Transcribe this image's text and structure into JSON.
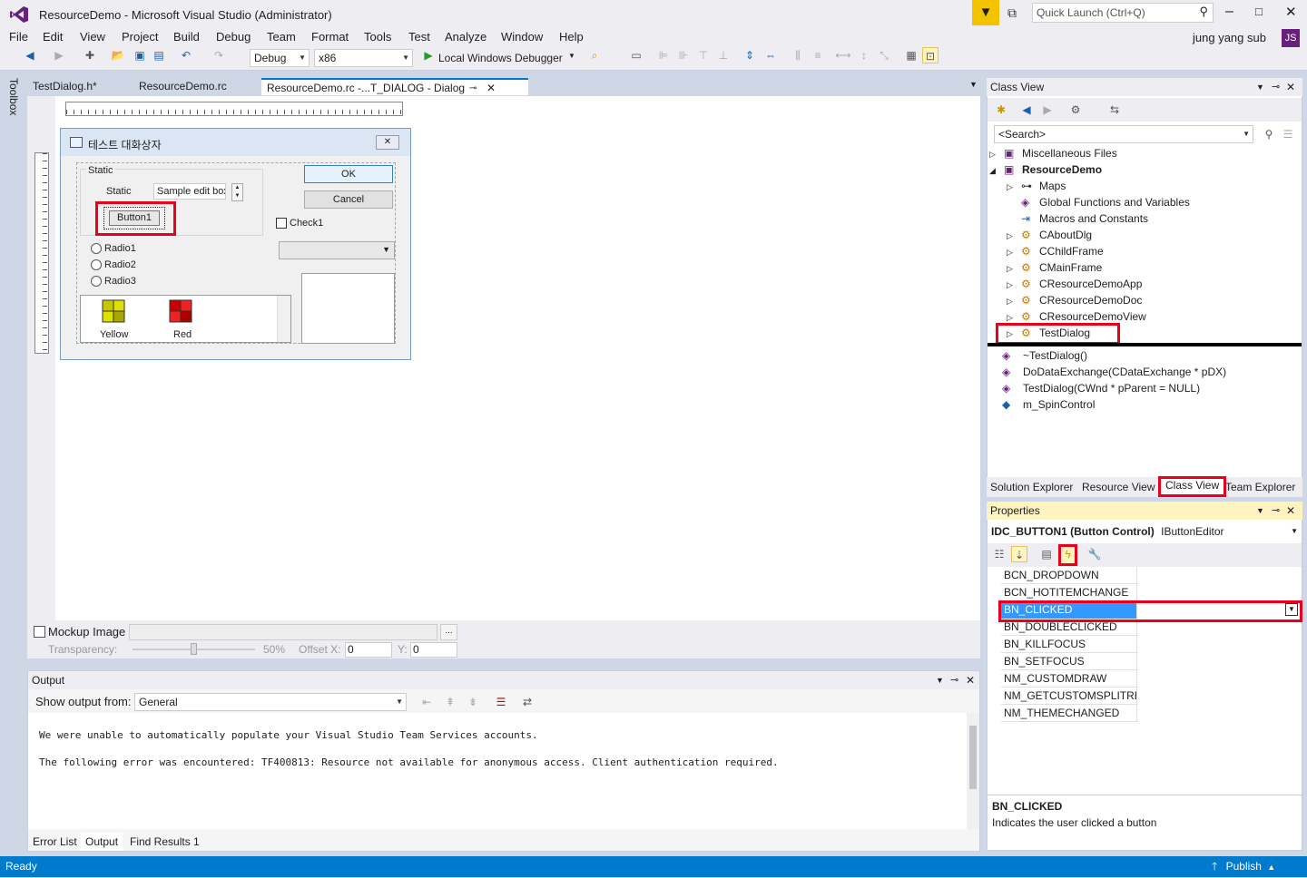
{
  "window": {
    "title": "ResourceDemo - Microsoft Visual Studio (Administrator)",
    "quick_launch_placeholder": "Quick Launch (Ctrl+Q)",
    "user": "jung yang sub",
    "user_initials": "JS"
  },
  "menu": [
    "File",
    "Edit",
    "View",
    "Project",
    "Build",
    "Debug",
    "Team",
    "Format",
    "Tools",
    "Test",
    "Analyze",
    "Window",
    "Help"
  ],
  "toolbar": {
    "config": "Debug",
    "platform": "x86",
    "debugger": "Local Windows Debugger"
  },
  "toolbox_label": "Toolbox",
  "doc_tabs": [
    "TestDialog.h*",
    "ResourceDemo.rc",
    "ResourceDemo.rc -...T_DIALOG - Dialog"
  ],
  "dialog": {
    "title": "테스트 대화상자",
    "group_label": "Static",
    "static_label": "Static",
    "edit_value": "Sample edit box",
    "button1": "Button1",
    "ok": "OK",
    "cancel": "Cancel",
    "check1": "Check1",
    "radios": [
      "Radio1",
      "Radio2",
      "Radio3"
    ],
    "list_items": [
      "Yellow",
      "Red"
    ]
  },
  "mockup": {
    "label": "Mockup Image",
    "transparency_label": "Transparency:",
    "transparency_value": "50%",
    "offset_x_label": "Offset X:",
    "offset_x": "0",
    "y_label": "Y:",
    "y": "0"
  },
  "output": {
    "title": "Output",
    "show_from_label": "Show output from:",
    "source": "General",
    "lines": [
      "We were unable to automatically populate your Visual Studio Team Services accounts.",
      "",
      "The following error was encountered: TF400813: Resource not available for anonymous access. Client authentication required."
    ]
  },
  "bottom_tabs": [
    "Error List",
    "Output",
    "Find Results 1"
  ],
  "class_view": {
    "title": "Class View",
    "search_placeholder": "<Search>",
    "tree": [
      {
        "label": "Miscellaneous Files",
        "level": 0,
        "expander": "▷"
      },
      {
        "label": "ResourceDemo",
        "level": 0,
        "expander": "◢",
        "bold": true
      },
      {
        "label": "Maps",
        "level": 1,
        "expander": "▷"
      },
      {
        "label": "Global Functions and Variables",
        "level": 1,
        "expander": ""
      },
      {
        "label": "Macros and Constants",
        "level": 1,
        "expander": ""
      },
      {
        "label": "CAboutDlg",
        "level": 1,
        "expander": "▷"
      },
      {
        "label": "CChildFrame",
        "level": 1,
        "expander": "▷"
      },
      {
        "label": "CMainFrame",
        "level": 1,
        "expander": "▷"
      },
      {
        "label": "CResourceDemoApp",
        "level": 1,
        "expander": "▷"
      },
      {
        "label": "CResourceDemoDoc",
        "level": 1,
        "expander": "▷"
      },
      {
        "label": "CResourceDemoView",
        "level": 1,
        "expander": "▷"
      },
      {
        "label": "TestDialog",
        "level": 1,
        "expander": "▷"
      }
    ],
    "members": [
      "~TestDialog()",
      "DoDataExchange(CDataExchange * pDX)",
      "TestDialog(CWnd * pParent = NULL)",
      "m_SpinControl"
    ]
  },
  "panel_tabs": [
    "Solution Explorer",
    "Resource View",
    "Class View",
    "Team Explorer"
  ],
  "properties": {
    "title": "Properties",
    "object": "IDC_BUTTON1 (Button Control)",
    "object_type": "IButtonEditor",
    "events": [
      "BCN_DROPDOWN",
      "BCN_HOTITEMCHANGE",
      "BN_CLICKED",
      "BN_DOUBLECLICKED",
      "BN_KILLFOCUS",
      "BN_SETFOCUS",
      "NM_CUSTOMDRAW",
      "NM_GETCUSTOMSPLITRECT",
      "NM_THEMECHANGED"
    ],
    "selected_event": "BN_CLICKED",
    "desc_title": "BN_CLICKED",
    "desc_text": "Indicates the user clicked a button"
  },
  "status": {
    "left": "Ready",
    "publish": "Publish"
  },
  "colors": {
    "accent": "#007acc",
    "highlight_red": "#e8001c",
    "vs_purple": "#68217a"
  }
}
